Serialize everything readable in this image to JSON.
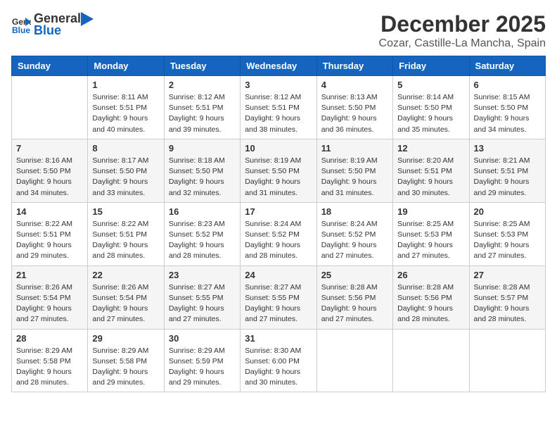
{
  "header": {
    "logo_general": "General",
    "logo_blue": "Blue",
    "month": "December 2025",
    "location": "Cozar, Castille-La Mancha, Spain"
  },
  "weekdays": [
    "Sunday",
    "Monday",
    "Tuesday",
    "Wednesday",
    "Thursday",
    "Friday",
    "Saturday"
  ],
  "weeks": [
    [
      {
        "day": "",
        "info": ""
      },
      {
        "day": "1",
        "info": "Sunrise: 8:11 AM\nSunset: 5:51 PM\nDaylight: 9 hours\nand 40 minutes."
      },
      {
        "day": "2",
        "info": "Sunrise: 8:12 AM\nSunset: 5:51 PM\nDaylight: 9 hours\nand 39 minutes."
      },
      {
        "day": "3",
        "info": "Sunrise: 8:12 AM\nSunset: 5:51 PM\nDaylight: 9 hours\nand 38 minutes."
      },
      {
        "day": "4",
        "info": "Sunrise: 8:13 AM\nSunset: 5:50 PM\nDaylight: 9 hours\nand 36 minutes."
      },
      {
        "day": "5",
        "info": "Sunrise: 8:14 AM\nSunset: 5:50 PM\nDaylight: 9 hours\nand 35 minutes."
      },
      {
        "day": "6",
        "info": "Sunrise: 8:15 AM\nSunset: 5:50 PM\nDaylight: 9 hours\nand 34 minutes."
      }
    ],
    [
      {
        "day": "7",
        "info": "Sunrise: 8:16 AM\nSunset: 5:50 PM\nDaylight: 9 hours\nand 34 minutes."
      },
      {
        "day": "8",
        "info": "Sunrise: 8:17 AM\nSunset: 5:50 PM\nDaylight: 9 hours\nand 33 minutes."
      },
      {
        "day": "9",
        "info": "Sunrise: 8:18 AM\nSunset: 5:50 PM\nDaylight: 9 hours\nand 32 minutes."
      },
      {
        "day": "10",
        "info": "Sunrise: 8:19 AM\nSunset: 5:50 PM\nDaylight: 9 hours\nand 31 minutes."
      },
      {
        "day": "11",
        "info": "Sunrise: 8:19 AM\nSunset: 5:50 PM\nDaylight: 9 hours\nand 31 minutes."
      },
      {
        "day": "12",
        "info": "Sunrise: 8:20 AM\nSunset: 5:51 PM\nDaylight: 9 hours\nand 30 minutes."
      },
      {
        "day": "13",
        "info": "Sunrise: 8:21 AM\nSunset: 5:51 PM\nDaylight: 9 hours\nand 29 minutes."
      }
    ],
    [
      {
        "day": "14",
        "info": "Sunrise: 8:22 AM\nSunset: 5:51 PM\nDaylight: 9 hours\nand 29 minutes."
      },
      {
        "day": "15",
        "info": "Sunrise: 8:22 AM\nSunset: 5:51 PM\nDaylight: 9 hours\nand 28 minutes."
      },
      {
        "day": "16",
        "info": "Sunrise: 8:23 AM\nSunset: 5:52 PM\nDaylight: 9 hours\nand 28 minutes."
      },
      {
        "day": "17",
        "info": "Sunrise: 8:24 AM\nSunset: 5:52 PM\nDaylight: 9 hours\nand 28 minutes."
      },
      {
        "day": "18",
        "info": "Sunrise: 8:24 AM\nSunset: 5:52 PM\nDaylight: 9 hours\nand 27 minutes."
      },
      {
        "day": "19",
        "info": "Sunrise: 8:25 AM\nSunset: 5:53 PM\nDaylight: 9 hours\nand 27 minutes."
      },
      {
        "day": "20",
        "info": "Sunrise: 8:25 AM\nSunset: 5:53 PM\nDaylight: 9 hours\nand 27 minutes."
      }
    ],
    [
      {
        "day": "21",
        "info": "Sunrise: 8:26 AM\nSunset: 5:54 PM\nDaylight: 9 hours\nand 27 minutes."
      },
      {
        "day": "22",
        "info": "Sunrise: 8:26 AM\nSunset: 5:54 PM\nDaylight: 9 hours\nand 27 minutes."
      },
      {
        "day": "23",
        "info": "Sunrise: 8:27 AM\nSunset: 5:55 PM\nDaylight: 9 hours\nand 27 minutes."
      },
      {
        "day": "24",
        "info": "Sunrise: 8:27 AM\nSunset: 5:55 PM\nDaylight: 9 hours\nand 27 minutes."
      },
      {
        "day": "25",
        "info": "Sunrise: 8:28 AM\nSunset: 5:56 PM\nDaylight: 9 hours\nand 27 minutes."
      },
      {
        "day": "26",
        "info": "Sunrise: 8:28 AM\nSunset: 5:56 PM\nDaylight: 9 hours\nand 28 minutes."
      },
      {
        "day": "27",
        "info": "Sunrise: 8:28 AM\nSunset: 5:57 PM\nDaylight: 9 hours\nand 28 minutes."
      }
    ],
    [
      {
        "day": "28",
        "info": "Sunrise: 8:29 AM\nSunset: 5:58 PM\nDaylight: 9 hours\nand 28 minutes."
      },
      {
        "day": "29",
        "info": "Sunrise: 8:29 AM\nSunset: 5:58 PM\nDaylight: 9 hours\nand 29 minutes."
      },
      {
        "day": "30",
        "info": "Sunrise: 8:29 AM\nSunset: 5:59 PM\nDaylight: 9 hours\nand 29 minutes."
      },
      {
        "day": "31",
        "info": "Sunrise: 8:30 AM\nSunset: 6:00 PM\nDaylight: 9 hours\nand 30 minutes."
      },
      {
        "day": "",
        "info": ""
      },
      {
        "day": "",
        "info": ""
      },
      {
        "day": "",
        "info": ""
      }
    ]
  ]
}
